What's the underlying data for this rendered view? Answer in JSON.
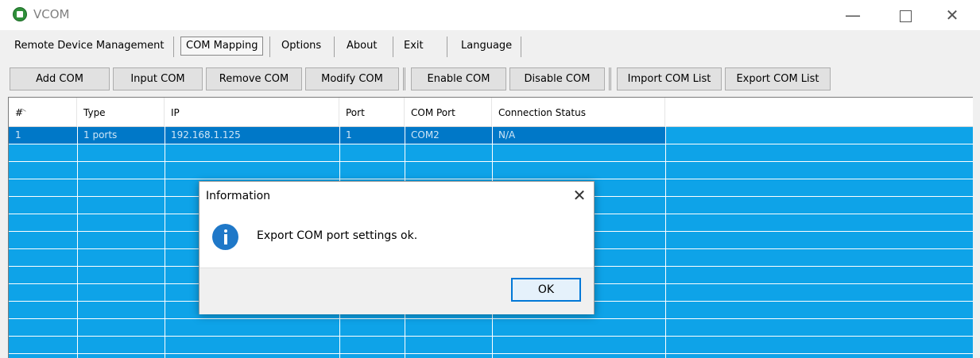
{
  "window": {
    "title": "VCOM",
    "controls": [
      "minimize-icon",
      "maximize-icon",
      "close-icon"
    ]
  },
  "menu": {
    "items": [
      "Remote Device Management",
      "COM Mapping",
      "Options",
      "About",
      "Exit",
      "Language"
    ],
    "active": "COM Mapping"
  },
  "toolbar": {
    "buttons": [
      "Add COM",
      "Input COM",
      "Remove COM",
      "Modify COM",
      "Enable COM",
      "Disable COM",
      "Import COM List",
      "Export COM List"
    ]
  },
  "table": {
    "columns": [
      "#",
      "Type",
      "IP",
      "Port",
      "COM Port",
      "Connection Status"
    ],
    "rows": [
      [
        "1",
        "1 ports",
        "192.168.1.125",
        "1",
        "COM2",
        "N/A"
      ]
    ],
    "selected_row": 0
  },
  "dialog": {
    "title": "Information",
    "message": "Export COM port settings ok.",
    "ok_label": "OK",
    "icon": "info-icon"
  },
  "colors": {
    "grid_background": "#0ea3e8",
    "selected_row": "#0078c8",
    "dialog_button_border": "#0078d7"
  }
}
